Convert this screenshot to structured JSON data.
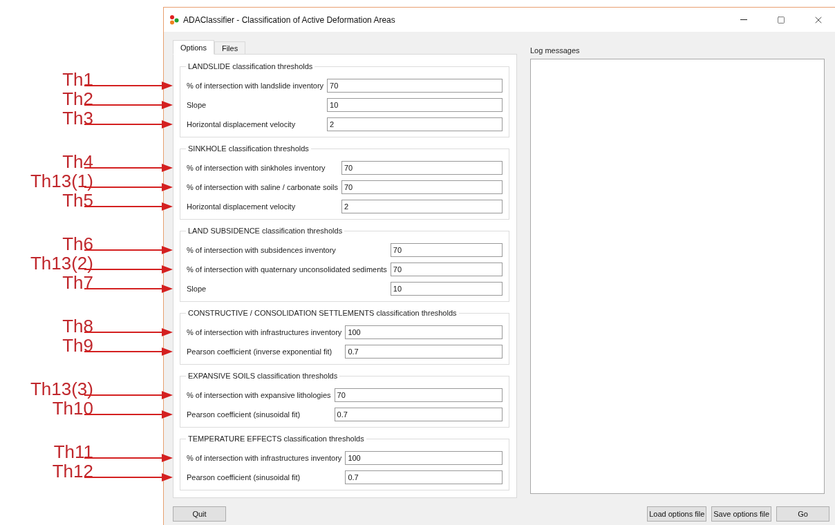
{
  "window": {
    "title": "ADAClassifier - Classification of Active Deformation Areas"
  },
  "tabs": [
    {
      "label": "Options",
      "selected": true
    },
    {
      "label": "Files",
      "selected": false
    }
  ],
  "groups": [
    {
      "title": "LANDSLIDE classification thresholds",
      "rows": [
        {
          "annotation": "Th1",
          "label": "% of intersection with landslide inventory",
          "value": "70"
        },
        {
          "annotation": "Th2",
          "label": "Slope",
          "value": "10"
        },
        {
          "annotation": "Th3",
          "label": "Horizontal displacement velocity",
          "value": "2"
        }
      ]
    },
    {
      "title": "SINKHOLE classification thresholds",
      "rows": [
        {
          "annotation": "Th4",
          "label": "% of intersection with sinkholes inventory",
          "value": "70"
        },
        {
          "annotation": "Th13(1)",
          "label": "% of intersection with saline / carbonate soils",
          "value": "70"
        },
        {
          "annotation": "Th5",
          "label": "Horizontal displacement velocity",
          "value": "2"
        }
      ]
    },
    {
      "title": "LAND SUBSIDENCE classification thresholds",
      "rows": [
        {
          "annotation": "Th6",
          "label": "% of intersection with subsidences inventory",
          "value": "70"
        },
        {
          "annotation": "Th13(2)",
          "label": "% of intersection with quaternary unconsolidated sediments",
          "value": "70"
        },
        {
          "annotation": "Th7",
          "label": "Slope",
          "value": "10"
        }
      ]
    },
    {
      "title": "CONSTRUCTIVE / CONSOLIDATION SETTLEMENTS classification thresholds",
      "rows": [
        {
          "annotation": "Th8",
          "label": "% of intersection with infrastructures inventory",
          "value": "100"
        },
        {
          "annotation": "Th9",
          "label": "Pearson coefficient (inverse exponential fit)",
          "value": "0.7"
        }
      ]
    },
    {
      "title": "EXPANSIVE SOILS classification thresholds",
      "rows": [
        {
          "annotation": "Th13(3)",
          "label": "% of intersection with expansive lithologies",
          "value": "70"
        },
        {
          "annotation": "Th10",
          "label": "Pearson coefficient (sinusoidal fit)",
          "value": "0.7"
        }
      ]
    },
    {
      "title": "TEMPERATURE EFFECTS classification thresholds",
      "rows": [
        {
          "annotation": "Th11",
          "label": "% of intersection with infrastructures inventory",
          "value": "100"
        },
        {
          "annotation": "Th12",
          "label": "Pearson coefficient (sinusoidal fit)",
          "value": "0.7"
        }
      ]
    }
  ],
  "log": {
    "label": "Log messages"
  },
  "quit_button": "Quit",
  "file_buttons": [
    "Load options file",
    "Save options file",
    "Go"
  ]
}
